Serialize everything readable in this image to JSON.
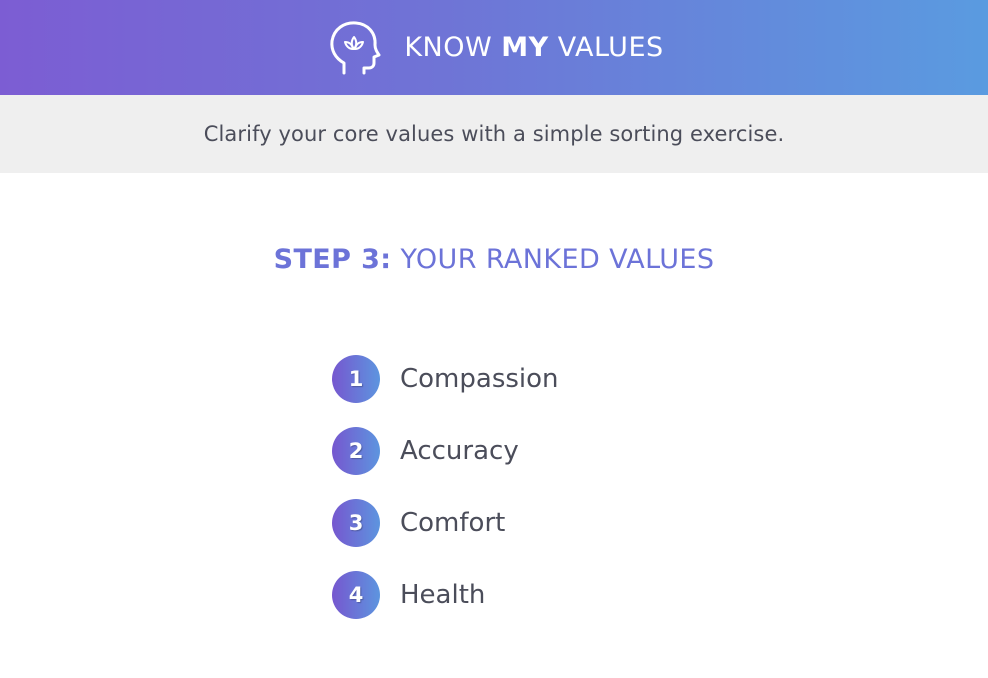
{
  "header": {
    "logo_icon": "head-lotus-icon",
    "title_part1": "KNOW ",
    "title_part2": "MY",
    "title_part3": " VALUES",
    "gradient_start": "#7c5dd3",
    "gradient_end": "#5a9be0"
  },
  "tagline": "Clarify your core values with a simple sorting exercise.",
  "step": {
    "prefix": "STEP 3:",
    "title": " YOUR RANKED VALUES",
    "color": "#6c73d8"
  },
  "ranked_values": [
    {
      "rank": "1",
      "label": "Compassion"
    },
    {
      "rank": "2",
      "label": "Accuracy"
    },
    {
      "rank": "3",
      "label": "Comfort"
    },
    {
      "rank": "4",
      "label": "Health"
    }
  ]
}
